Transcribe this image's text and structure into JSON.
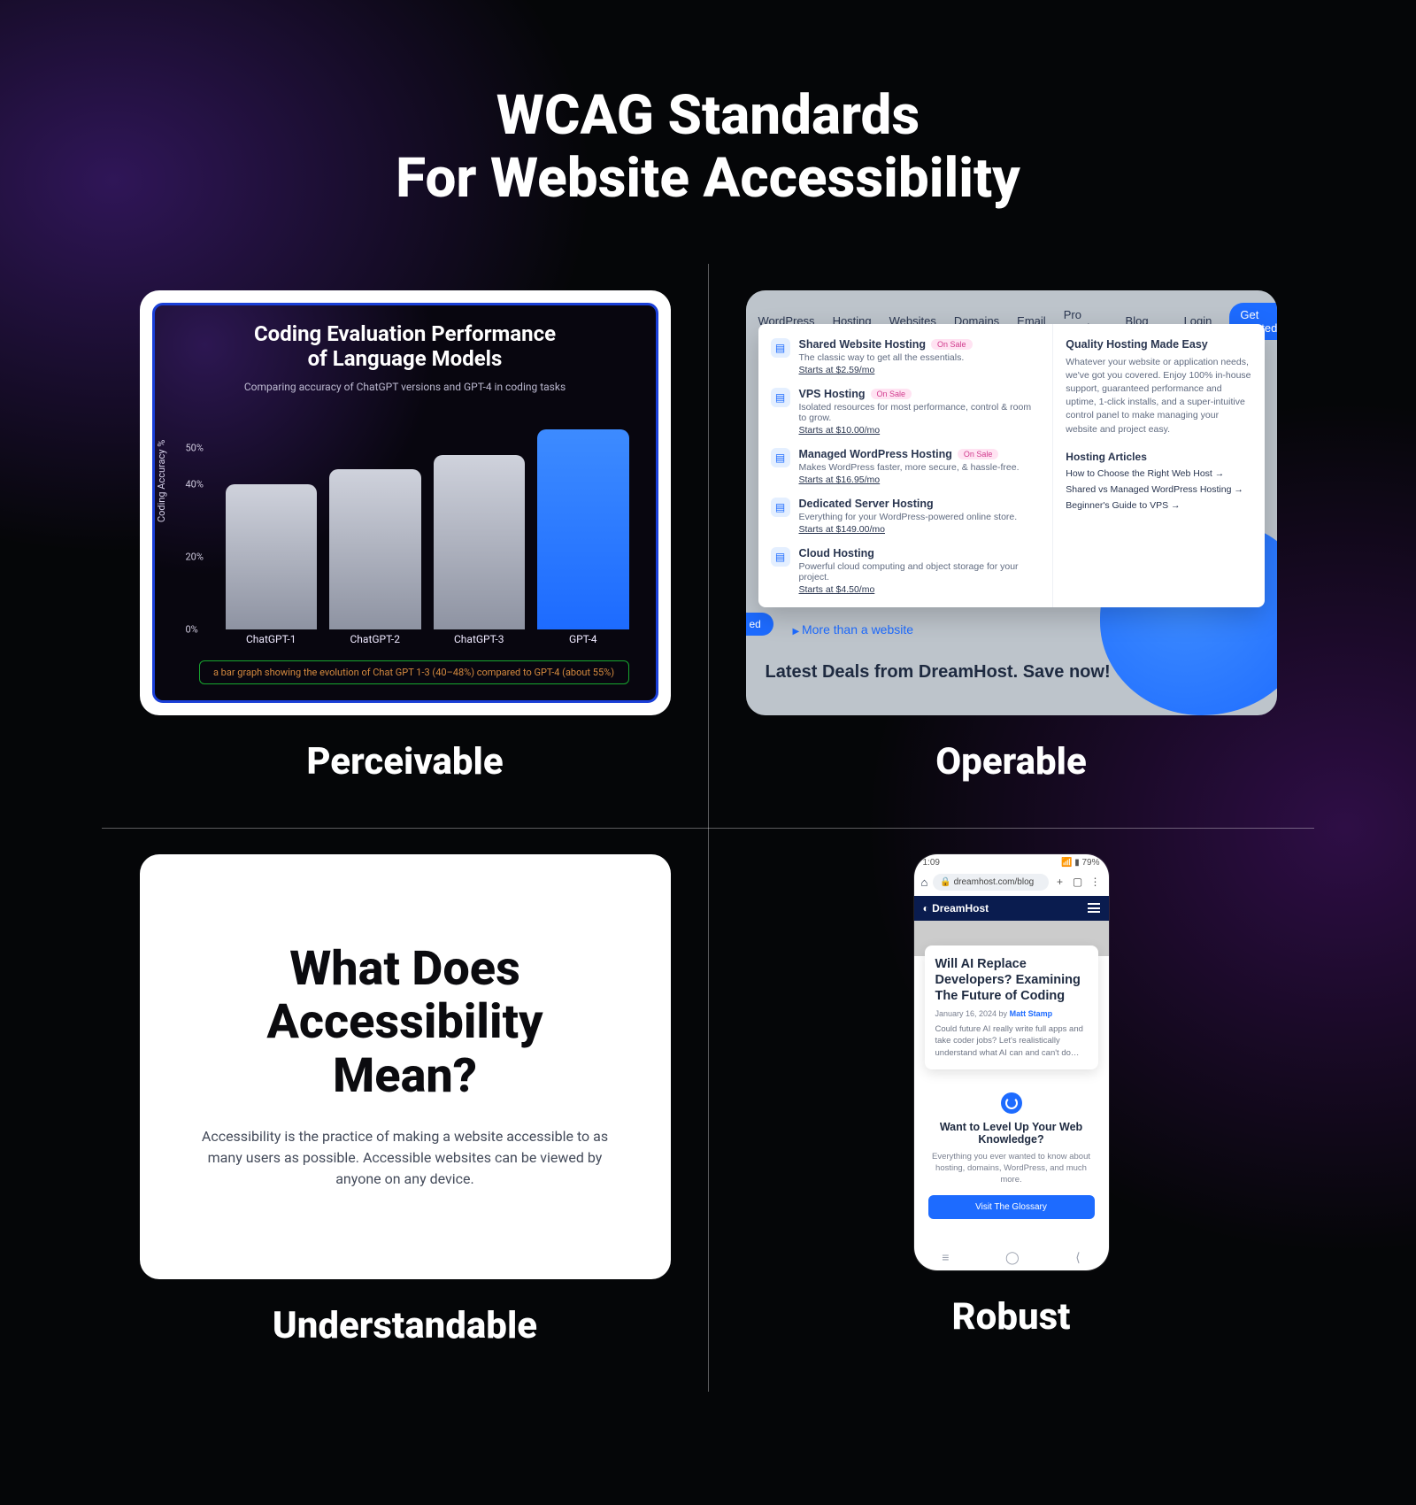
{
  "title_line1": "WCAG Standards",
  "title_line2": "For Website Accessibility",
  "quads": {
    "perceivable": "Perceivable",
    "operable": "Operable",
    "understandable": "Understandable",
    "robust": "Robust"
  },
  "chart_data": {
    "type": "bar",
    "title_l1": "Coding Evaluation Performance",
    "title_l2": "of Language Models",
    "subtitle": "Comparing accuracy of ChatGPT versions and GPT-4 in coding tasks",
    "ylabel": "Coding Accuracy  %",
    "ticks": [
      "0%",
      "20%",
      "40%",
      "50%"
    ],
    "tick_vals": [
      0,
      20,
      40,
      50
    ],
    "ylim": [
      0,
      60
    ],
    "categories": [
      "ChatGPT-1",
      "ChatGPT-2",
      "ChatGPT-3",
      "GPT-4"
    ],
    "values": [
      40,
      44,
      48,
      55
    ],
    "highlight_index": 3,
    "alt_text": "a bar graph showing the evolution of Chat GPT 1-3 (40–48%) compared to GPT-4 (about 55%)"
  },
  "operable": {
    "nav": [
      "WordPress",
      "Hosting",
      "Websites",
      "Domains",
      "Email",
      "Pro Services",
      "Blog"
    ],
    "login": "Login",
    "cta": "Get Started",
    "items": [
      {
        "title": "Shared Website Hosting",
        "sale": true,
        "desc": "The classic way to get all the essentials.",
        "price": "Starts at $2.59/mo"
      },
      {
        "title": "VPS Hosting",
        "sale": true,
        "desc": "Isolated resources for most performance, control & room to grow.",
        "price": "Starts at $10.00/mo"
      },
      {
        "title": "Managed WordPress Hosting",
        "sale": true,
        "desc": "Makes WordPress faster, more secure, & hassle-free.",
        "price": "Starts at $16.95/mo"
      },
      {
        "title": "Dedicated Server Hosting",
        "sale": false,
        "desc": "Everything for your WordPress-powered online store.",
        "price": "Starts at $149.00/mo"
      },
      {
        "title": "Cloud Hosting",
        "sale": false,
        "desc": "Powerful cloud computing and object storage for your project.",
        "price": "Starts at $4.50/mo"
      }
    ],
    "right_heading": "Quality Hosting Made Easy",
    "right_body": "Whatever your website or application needs, we've got you covered. Enjoy 100% in-house support, guaranteed performance and uptime, 1-click installs, and a super-intuitive control panel to make managing your website and project easy.",
    "articles_heading": "Hosting Articles",
    "articles": [
      "How to Choose the Right Web Host",
      "Shared vs Managed WordPress Hosting",
      "Beginner's Guide to VPS"
    ],
    "more_than": "More than a website",
    "deals": "Latest Deals from DreamHost. Save now!",
    "pill": "ed",
    "sale_label": "On Sale"
  },
  "understandable": {
    "heading_l1": "What Does",
    "heading_l2": "Accessibility",
    "heading_l3": "Mean?",
    "body": "Accessibility is the practice of making a website accessible to as many users as possible. Accessible websites can be viewed by anyone on any device."
  },
  "robust": {
    "time": "1:09",
    "battery": "79%",
    "url": "dreamhost.com/blog",
    "brand": "DreamHost",
    "article_title": "Will AI Replace Developers? Examining The Future of Coding",
    "article_date": "January 16, 2024 by",
    "article_author": "Matt Stamp",
    "article_excerpt": "Could future AI really write full apps and take coder jobs? Let's realistically understand what AI can and can't do…",
    "level_heading": "Want to Level Up Your Web Knowledge?",
    "level_body": "Everything you ever wanted to know about hosting, domains, WordPress, and much more.",
    "level_cta": "Visit The Glossary"
  }
}
